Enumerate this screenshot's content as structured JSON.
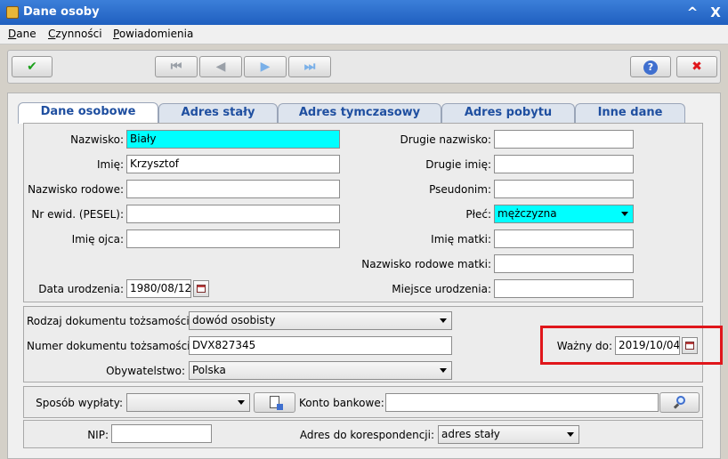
{
  "window": {
    "title": "Dane osoby",
    "min_glyph": "^",
    "close_glyph": "X"
  },
  "menu": [
    {
      "label": "Dane",
      "underline_index": 0
    },
    {
      "label": "Czynności",
      "underline_index": 0
    },
    {
      "label": "Powiadomienia",
      "underline_index": 0
    }
  ],
  "toolbar": {
    "ok_glyph": "✔",
    "first_glyph": "⏮",
    "prev_glyph": "◀",
    "next_glyph": "▶",
    "last_glyph": "⏭",
    "help_glyph": "?",
    "cancel_glyph": "✖"
  },
  "tabs": [
    {
      "label": "Dane osobowe",
      "active": true
    },
    {
      "label": "Adres stały"
    },
    {
      "label": "Adres tymczasowy"
    },
    {
      "label": "Adres pobytu"
    },
    {
      "label": "Inne dane"
    }
  ],
  "personal": {
    "surname_label": "Nazwisko:",
    "surname_value": "Biały",
    "first_name_label": "Imię:",
    "first_name_value": "Krzysztof",
    "family_name_label": "Nazwisko rodowe:",
    "family_name_value": "",
    "pesel_label": "Nr ewid. (PESEL):",
    "pesel_value": "",
    "father_name_label": "Imię ojca:",
    "father_name_value": "",
    "birth_date_label": "Data urodzenia:",
    "birth_date_value": "1980/08/12",
    "second_surname_label": "Drugie nazwisko:",
    "second_surname_value": "",
    "second_name_label": "Drugie imię:",
    "second_name_value": "",
    "pseudonym_label": "Pseudonim:",
    "pseudonym_value": "",
    "sex_label": "Płeć:",
    "sex_value": "mężczyzna",
    "mother_name_label": "Imię matki:",
    "mother_name_value": "",
    "mother_family_name_label": "Nazwisko rodowe matki:",
    "mother_family_name_value": "",
    "birth_place_label": "Miejsce urodzenia:",
    "birth_place_value": ""
  },
  "document": {
    "type_label": "Rodzaj dokumentu tożsamości:",
    "type_value": "dowód osobisty",
    "number_label": "Numer dokumentu tożsamości:",
    "number_value": "DVX827345",
    "citizenship_label": "Obywatelstwo:",
    "citizenship_value": "Polska",
    "valid_label": "Ważny do:",
    "valid_value": "2019/10/04"
  },
  "payment": {
    "method_label": "Sposób wypłaty:",
    "method_value": "",
    "account_label": "Konto bankowe:",
    "account_value": ""
  },
  "tax": {
    "nip_label": "NIP:",
    "nip_value": "",
    "correspondence_label": "Adres do korespondencji:",
    "correspondence_value": "adres stały"
  },
  "colors": {
    "required_field": "#00ffff",
    "highlight": "#e0161b",
    "titlebar": "#2a6fd0"
  }
}
